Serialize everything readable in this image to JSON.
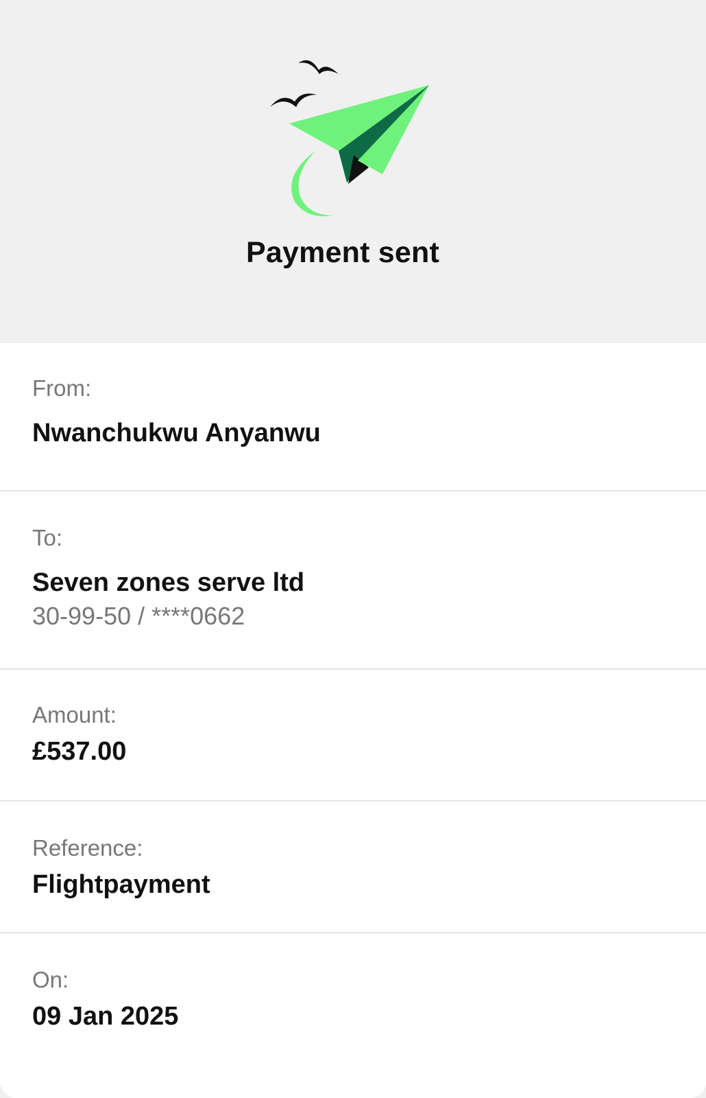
{
  "header": {
    "title": "Payment sent",
    "illustration_icon": "paper-plane-icon",
    "colors": {
      "plane_light": "#6ff27c",
      "plane_dark": "#0f6b45",
      "birds": "#111111"
    }
  },
  "details": {
    "from": {
      "label": "From:",
      "value": "Nwanchukwu Anyanwu"
    },
    "to": {
      "label": "To:",
      "value": "Seven zones serve ltd",
      "account": "30-99-50 / ****0662"
    },
    "amount": {
      "label": "Amount:",
      "value": "£537.00"
    },
    "reference": {
      "label": "Reference:",
      "value": "Flightpayment"
    },
    "date": {
      "label": "On:",
      "value": "09 Jan 2025"
    }
  }
}
